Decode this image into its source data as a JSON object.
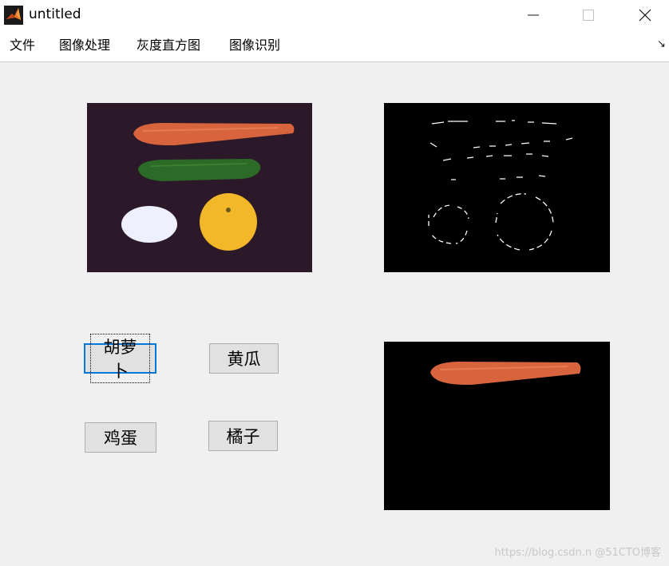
{
  "window": {
    "title": "untitled"
  },
  "menu": {
    "items": [
      "文件",
      "图像处理",
      "灰度直方图",
      "图像识别"
    ]
  },
  "buttons": {
    "carrot": "胡萝卜",
    "cucumber": "黄瓜",
    "egg": "鸡蛋",
    "orange": "橘子"
  },
  "watermark": "https://blog.csdn.n @51CTO博客",
  "colors": {
    "carrot": "#d8643e",
    "cucumber": "#2b6a27",
    "egg": "#eef0ff",
    "orange": "#f2b82a",
    "photo_bg": "#2b1828",
    "focus": "#0078d7"
  }
}
